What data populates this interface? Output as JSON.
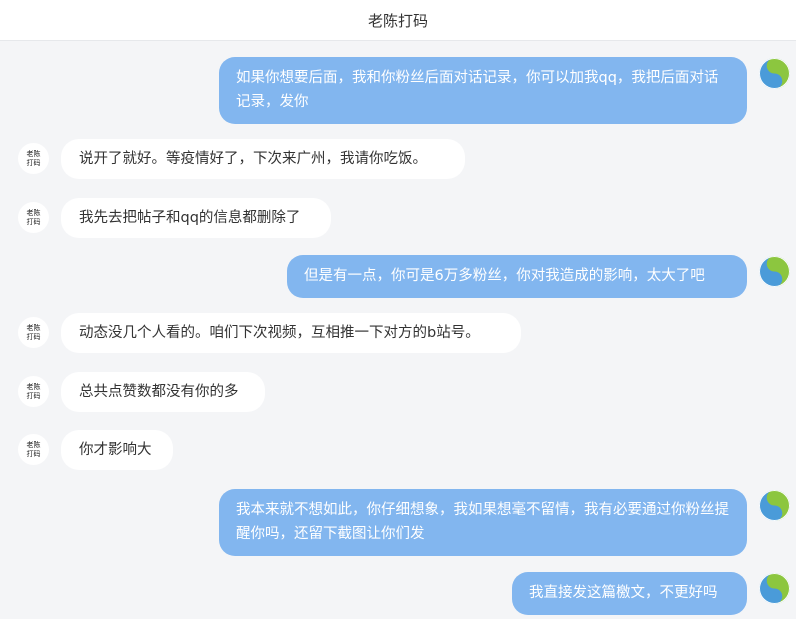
{
  "header": {
    "title": "老陈打码"
  },
  "avatar_left_text": {
    "line1": "老陈",
    "line2": "打码"
  },
  "messages": [
    {
      "side": "right",
      "text": "如果你想要后面，我和你粉丝后面对话记录，你可以加我qq，我把后面对话记录，发你"
    },
    {
      "side": "left",
      "text": "说开了就好。等疫情好了，下次来广州，我请你吃饭。"
    },
    {
      "side": "left",
      "text": "我先去把帖子和qq的信息都删除了"
    },
    {
      "side": "right",
      "text": "但是有一点，你可是6万多粉丝，你对我造成的影响，太大了吧"
    },
    {
      "side": "left",
      "text": "动态没几个人看的。咱们下次视频，互相推一下对方的b站号。"
    },
    {
      "side": "left",
      "text": "总共点赞数都没有你的多"
    },
    {
      "side": "left",
      "text": "你才影响大"
    },
    {
      "side": "right",
      "text": "我本来就不想如此，你仔细想象，我如果想毫不留情，我有必要通过你粉丝提醒你吗，还留下截图让你们发"
    },
    {
      "side": "right",
      "text": "我直接发这篇檄文，不更好吗"
    }
  ]
}
